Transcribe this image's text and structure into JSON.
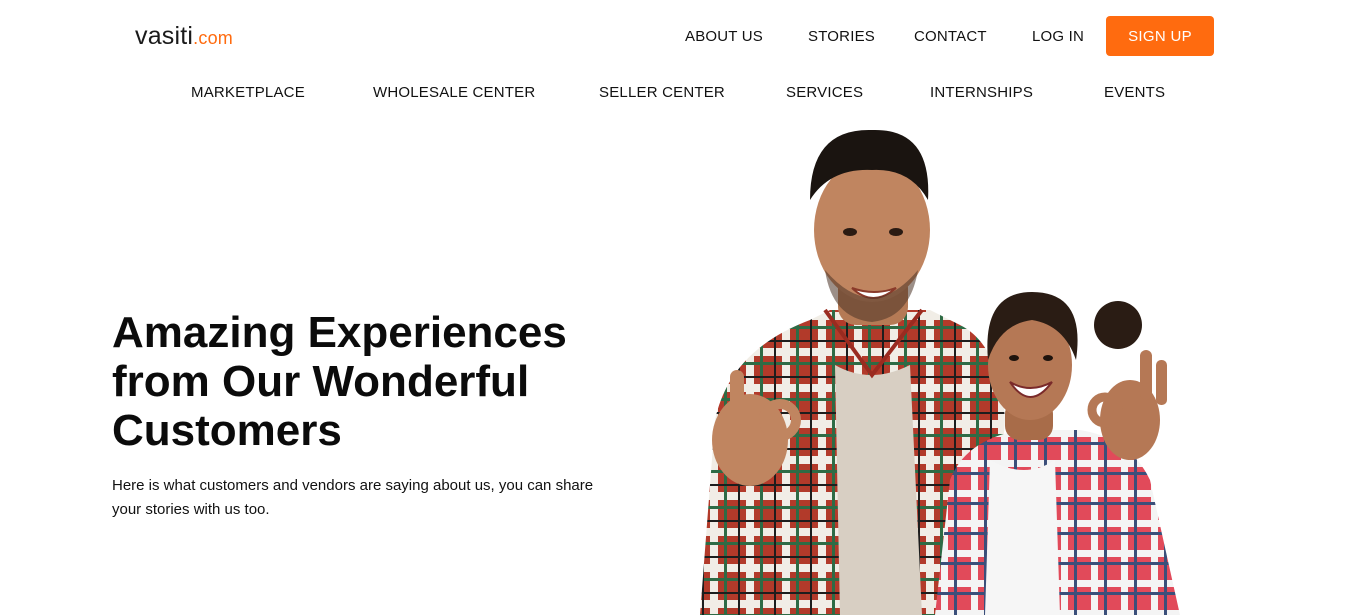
{
  "brand": {
    "name": "vasiti",
    "tld": ".com",
    "accent": "#ff6b0f"
  },
  "topnav": {
    "about": "ABOUT US",
    "stories": "STORIES",
    "contact": "CONTACT",
    "login": "LOG IN",
    "signup": "SIGN UP"
  },
  "subnav": [
    "MARKETPLACE",
    "WHOLESALE CENTER",
    "SELLER CENTER",
    "SERVICES",
    "INTERNSHIPS",
    "EVENTS"
  ],
  "hero": {
    "headline_lines": [
      "Amazing Experiences",
      "from Our Wonderful",
      "Customers"
    ],
    "subtext_lines": [
      "Here is what customers and vendors are saying about us, you can share",
      "your stories with us too."
    ]
  }
}
